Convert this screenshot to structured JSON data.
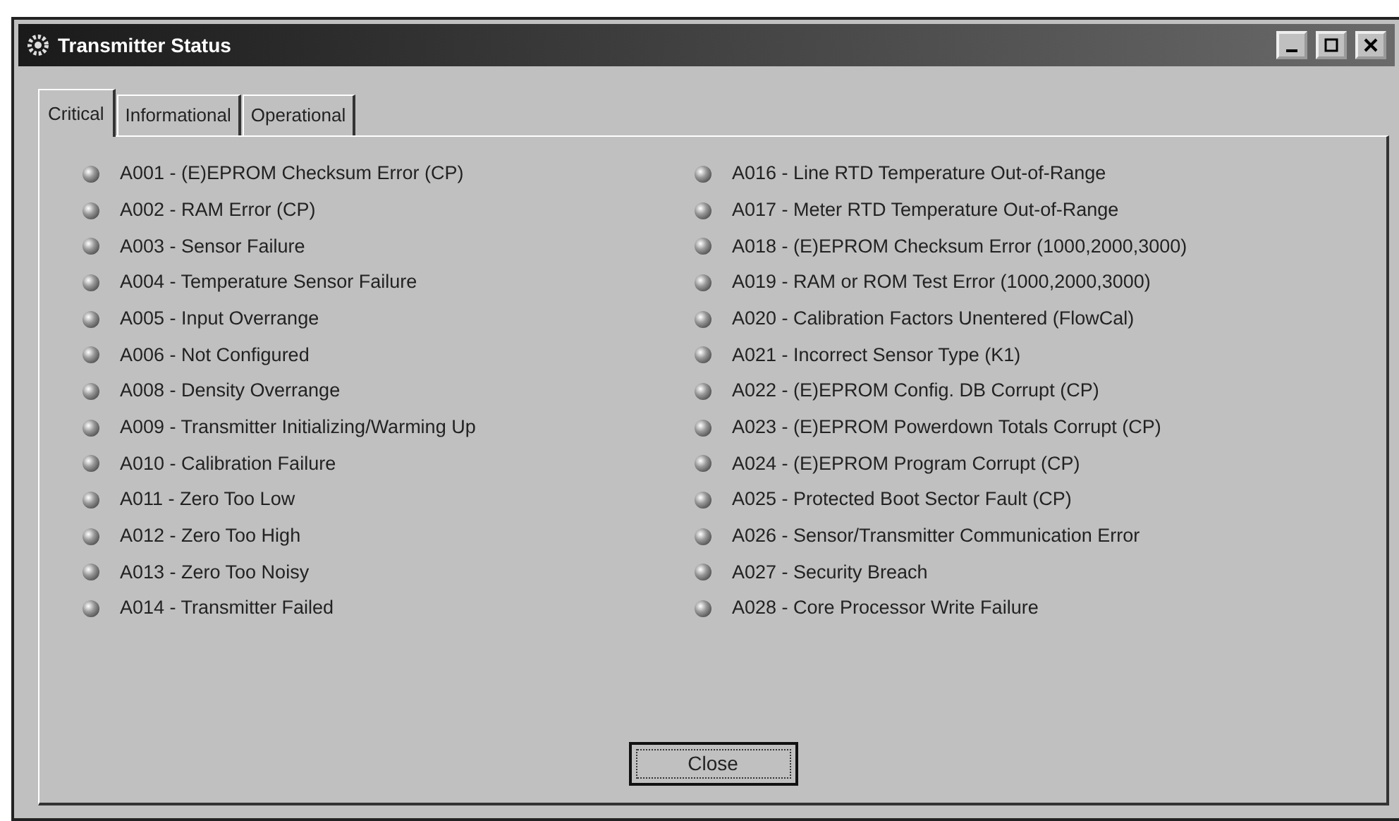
{
  "window": {
    "title": "Transmitter Status"
  },
  "tabs": [
    {
      "label": "Critical",
      "selected": true
    },
    {
      "label": "Informational",
      "selected": false
    },
    {
      "label": "Operational",
      "selected": false
    }
  ],
  "columns": [
    {
      "alarms": [
        "A001 - (E)EPROM Checksum Error (CP)",
        "A002 - RAM Error (CP)",
        "A003 - Sensor Failure",
        "A004 - Temperature Sensor Failure",
        "A005 - Input Overrange",
        "A006 - Not Configured",
        "A008 - Density Overrange",
        "A009 - Transmitter Initializing/Warming Up",
        "A010 - Calibration Failure",
        "A011 - Zero Too Low",
        "A012 - Zero Too High",
        "A013 - Zero Too Noisy",
        "A014 - Transmitter Failed"
      ]
    },
    {
      "alarms": [
        "A016 - Line RTD Temperature Out-of-Range",
        "A017 - Meter RTD Temperature Out-of-Range",
        "A018 - (E)EPROM Checksum Error (1000,2000,3000)",
        "A019 - RAM or ROM Test Error (1000,2000,3000)",
        "A020 - Calibration Factors Unentered (FlowCal)",
        "A021 - Incorrect Sensor Type (K1)",
        "A022 - (E)EPROM Config. DB Corrupt (CP)",
        "A023 - (E)EPROM Powerdown Totals Corrupt (CP)",
        "A024 - (E)EPROM Program Corrupt (CP)",
        "A025 - Protected Boot Sector Fault (CP)",
        "A026 - Sensor/Transmitter Communication Error",
        "A027 - Security Breach",
        "A028 - Core Processor Write Failure"
      ]
    }
  ],
  "close_button": "Close"
}
